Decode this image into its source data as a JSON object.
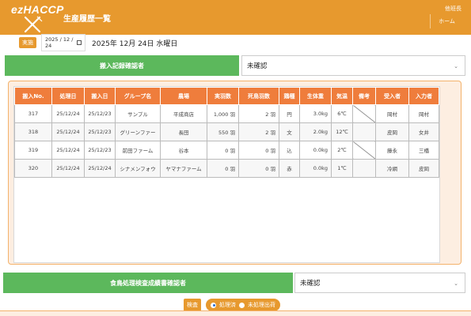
{
  "header": {
    "logo": "ezHACCP",
    "title": "生産履歴一覧",
    "user": "他班長",
    "home_label": "ホーム"
  },
  "date_row": {
    "label": "実施",
    "input_value": "2025 / 12 / 24",
    "display": "2025年 12月 24日 水曜日"
  },
  "section1": {
    "bar_label": "搬入記録確認者",
    "select_value": "未確認"
  },
  "table": {
    "headers": [
      "搬入No.",
      "処理日",
      "搬入日",
      "グループ名",
      "農場",
      "実羽数",
      "死鳥羽数",
      "鶏種",
      "生体重",
      "気温",
      "備考",
      "受入者",
      "入力者"
    ],
    "rows": [
      [
        "317",
        "25/12/24",
        "25/12/23",
        "サンプル",
        "平成商店",
        "1,000 羽",
        "2 羽",
        "円",
        "3.0kg",
        "6℃",
        "",
        "岡村",
        "岡村"
      ],
      [
        "318",
        "25/12/24",
        "25/12/23",
        "グリーンファー",
        "長田",
        "550 羽",
        "2 羽",
        "文",
        "2.0kg",
        "12℃",
        "",
        "皮岡",
        "女井"
      ],
      [
        "319",
        "25/12/24",
        "25/12/23",
        "前田ファーム",
        "谷本",
        "0 羽",
        "0 羽",
        "込",
        "0.0kg",
        "2℃",
        "",
        "藤永",
        "三橋"
      ],
      [
        "320",
        "25/12/24",
        "25/12/24",
        "シナメンフォウ",
        "ヤマナファーム",
        "0 羽",
        "0 羽",
        "赤",
        "0.0kg",
        "1℃",
        "",
        "冷網",
        "皮岡"
      ]
    ]
  },
  "section2": {
    "bar_label": "食鳥処理検査成績書確認者",
    "select_value": "未確認"
  },
  "bottom": {
    "kensa_label": "検査",
    "radio1": "処理済",
    "radio2": "未処理出荷"
  },
  "colors": {
    "header": "#e7992e",
    "green": "#5cb85c",
    "table_header": "#ef7d3c",
    "panel_bg": "#fdeee1"
  }
}
